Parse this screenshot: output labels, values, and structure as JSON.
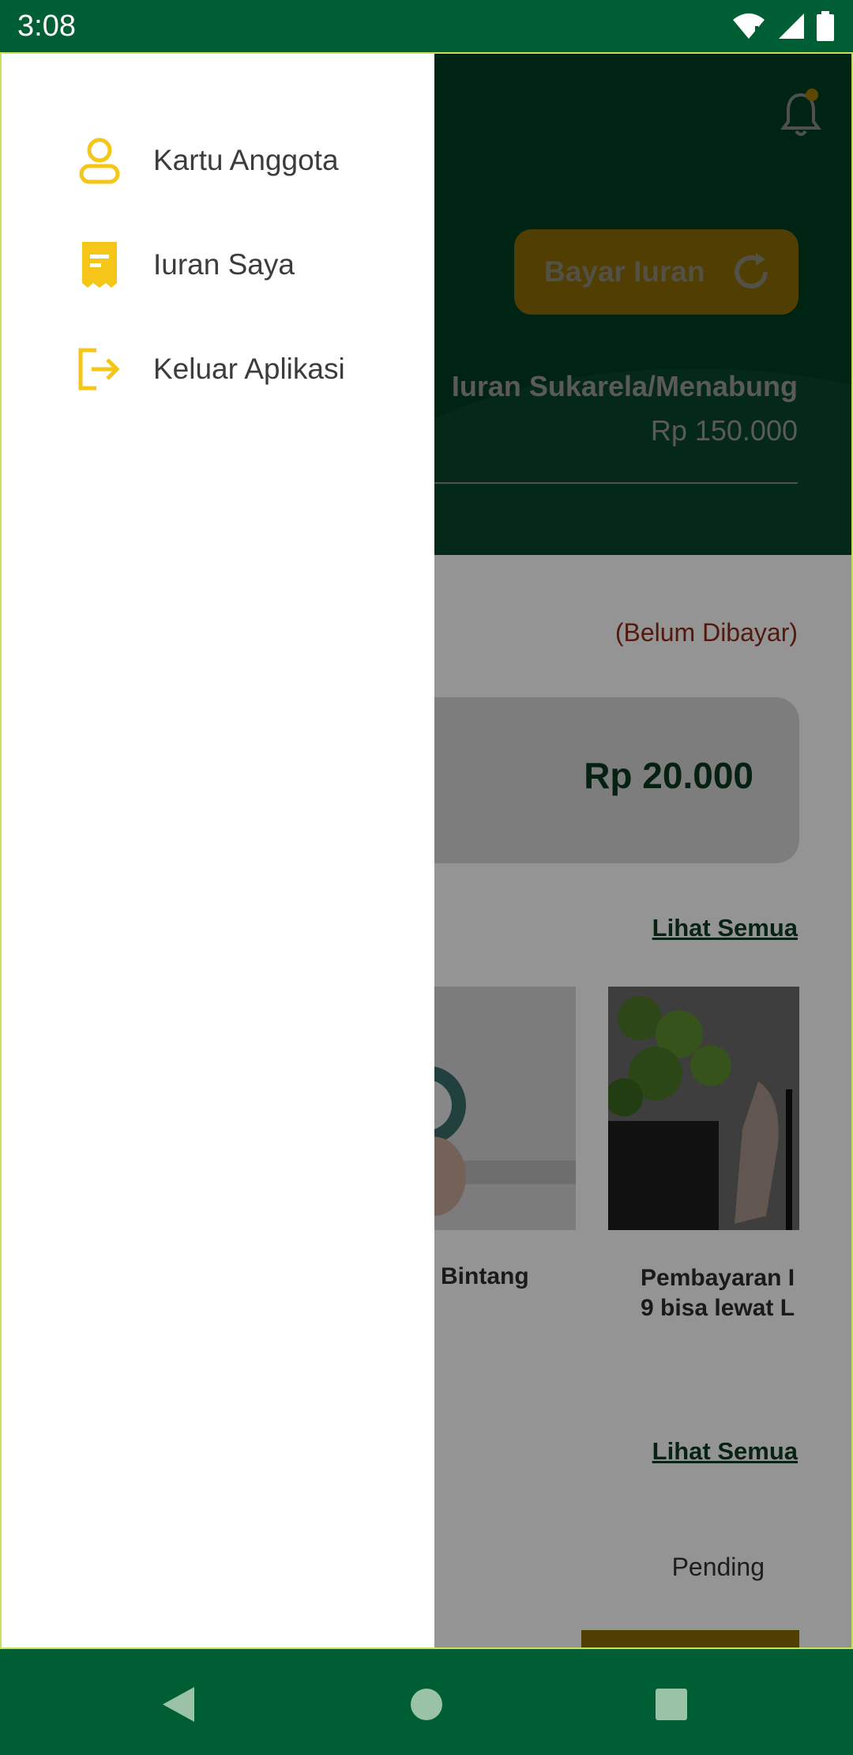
{
  "status_bar": {
    "time": "3:08"
  },
  "background": {
    "bayar_button": "Bayar Iuran",
    "iuran_title": "Iuran Sukarela/Menabung",
    "iuran_amount": "Rp 150.000",
    "payment_status": "(Belum Dibayar)",
    "amount": "Rp 20.000",
    "see_all_1": "Lihat Semua",
    "news": [
      {
        "title": "Bintang"
      },
      {
        "title": "Pembayaran I\n9 bisa lewat L"
      }
    ],
    "see_all_2": "Lihat Semua",
    "transaction_status": "Pending"
  },
  "drawer": {
    "items": [
      {
        "label": "Kartu Anggota",
        "icon": "person-icon"
      },
      {
        "label": "Iuran Saya",
        "icon": "receipt-icon"
      },
      {
        "label": "Keluar Aplikasi",
        "icon": "logout-icon"
      }
    ]
  },
  "colors": {
    "primary": "#005e34",
    "accent": "#f5c518",
    "drawer_icon": "#f5c518"
  }
}
